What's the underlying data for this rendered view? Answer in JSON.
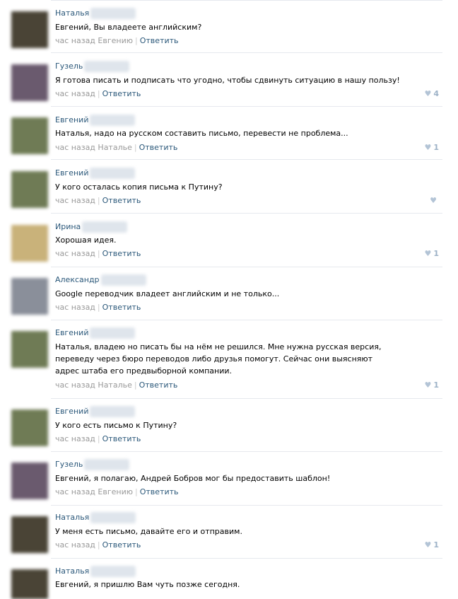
{
  "comments": [
    {
      "author": "Наталья",
      "text": "Евгений, Вы владеете английским?",
      "time": "час назад",
      "reply_to": "Евгению",
      "reply_label": "Ответить",
      "likes": "",
      "avatar_color": "#4a4436"
    },
    {
      "author": "Гузель",
      "text": "Я готова писать и подписать что угодно, чтобы сдвинуть ситуацию в нашу пользу!",
      "time": "час назад",
      "reply_to": "",
      "reply_label": "Ответить",
      "likes": "4",
      "avatar_color": "#6a5a6e"
    },
    {
      "author": "Евгений",
      "text": "Наталья, надо на русском составить письмо, перевести не проблема...",
      "time": "час назад",
      "reply_to": "Наталье",
      "reply_label": "Ответить",
      "likes": "1",
      "avatar_color": "#6f7b55"
    },
    {
      "author": "Евгений",
      "text": "У кого осталась копия письма к Путину?",
      "time": "час назад",
      "reply_to": "",
      "reply_label": "Ответить",
      "likes": "",
      "avatar_color": "#6f7b55"
    },
    {
      "author": "Ирина",
      "text": "Хорошая идея.",
      "time": "час назад",
      "reply_to": "",
      "reply_label": "Ответить",
      "likes": "1",
      "avatar_color": "#c9b27a"
    },
    {
      "author": "Александр",
      "text": "Google переводчик владеет английским и не только...",
      "time": "час назад",
      "reply_to": "",
      "reply_label": "Ответить",
      "likes": "",
      "avatar_color": "#8a8f9a"
    },
    {
      "author": "Евгений",
      "text": "Наталья, владею но писать бы на нём не решился. Мне нужна русская версия, переведу через бюро переводов либо друзья помогут. Сейчас они выясняют адрес штаба его предвыборной компании.",
      "time": "час назад",
      "reply_to": "Наталье",
      "reply_label": "Ответить",
      "likes": "1",
      "avatar_color": "#6f7b55"
    },
    {
      "author": "Евгений",
      "text": "У кого есть письмо к Путину?",
      "time": "час назад",
      "reply_to": "",
      "reply_label": "Ответить",
      "likes": "",
      "avatar_color": "#6f7b55"
    },
    {
      "author": "Гузель",
      "text": "Евгений, я полагаю, Андрей Бобров мог бы предоставить шаблон!",
      "time": "час назад",
      "reply_to": "Евгению",
      "reply_label": "Ответить",
      "likes": "",
      "avatar_color": "#6a5a6e"
    },
    {
      "author": "Наталья",
      "text": "У меня есть письмо, давайте его и отправим.",
      "time": "час назад",
      "reply_to": "",
      "reply_label": "Ответить",
      "likes": "1",
      "avatar_color": "#4a4436"
    },
    {
      "author": "Наталья",
      "text": "Евгений, я пришлю Вам чуть позже сегодня.",
      "time": "",
      "reply_to": "",
      "reply_label": "",
      "likes": "",
      "avatar_color": "#4a4436"
    }
  ]
}
